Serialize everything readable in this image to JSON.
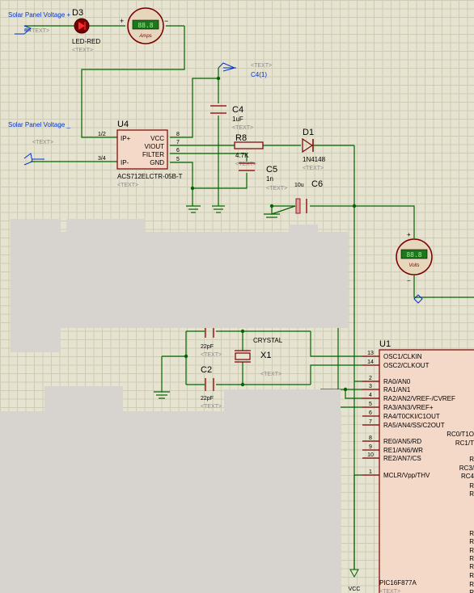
{
  "colors": {
    "wire": "#006400",
    "pin": "#7a0000",
    "body": "#f5d9c8",
    "text": "#000000",
    "label": "#8a8a8a",
    "net": "#0033cc",
    "cap": "#9a1c1c",
    "meter": "#e6d6bc",
    "meterLcd": "#1a7a1a",
    "occluder": "#d7d3cf"
  },
  "terminals": {
    "panel_plus": "Solar Panel Voltage +",
    "panel_minus": "Solar Panel Voltage _",
    "text_tag": "<TEXT>",
    "c4_tag": "C4(1)",
    "vcc": "VCC"
  },
  "d3": {
    "ref": "D3",
    "value": "LED-RED",
    "tag": "<TEXT>"
  },
  "ammeter": {
    "caption": "Amps",
    "plus": "+",
    "minus": "−",
    "lcd": "88.8"
  },
  "voltmeter": {
    "caption": "Volts",
    "plus": "+",
    "minus": "−",
    "lcd": "88.8"
  },
  "u4": {
    "ref": "U4",
    "part": "ACS712ELCTR-05B-T",
    "tag": "<TEXT>",
    "pins_left": [
      {
        "label": "IP+",
        "num": "1/2"
      },
      {
        "label": "IP-",
        "num": "3/4"
      }
    ],
    "pins_right": [
      {
        "label": "VCC",
        "num": "8"
      },
      {
        "label": "VIOUT",
        "num": "7"
      },
      {
        "label": "FILTER",
        "num": "6"
      },
      {
        "label": "GND",
        "num": "5"
      }
    ]
  },
  "c4": {
    "ref": "C4",
    "value": "1uF",
    "tag": "<TEXT>"
  },
  "r8": {
    "ref": "R8",
    "value": "4.7K",
    "tag": "<TEXT>"
  },
  "c5": {
    "ref": "C5",
    "value": "1n",
    "tag": "<TEXT>"
  },
  "d1": {
    "ref": "D1",
    "value": "1N4148",
    "tag": "<TEXT>"
  },
  "c6": {
    "ref": "C6",
    "value": "10u",
    "tag": "<TEXT>"
  },
  "crystal": {
    "name": "CRYSTAL",
    "ref": "X1",
    "tag": "<TEXT>"
  },
  "c1": {
    "value": "22pF",
    "tag": "<TEXT>"
  },
  "c2": {
    "ref": "C2",
    "value": "22pF",
    "tag": "<TEXT>"
  },
  "u1": {
    "ref": "U1",
    "part": "PIC16F877A",
    "pins": [
      {
        "num": "13",
        "label": "OSC1/CLKIN"
      },
      {
        "num": "14",
        "label": "OSC2/CLKOUT"
      },
      {
        "num": "2",
        "label": "RA0/AN0"
      },
      {
        "num": "3",
        "label": "RA1/AN1"
      },
      {
        "num": "4",
        "label": "RA2/AN2/VREF-/CVREF"
      },
      {
        "num": "5",
        "label": "RA3/AN3/VREF+"
      },
      {
        "num": "6",
        "label": "RA4/T0CKI/C1OUT"
      },
      {
        "num": "7",
        "label": "RA5/AN4/SS/C2OUT"
      },
      {
        "num": "8",
        "label": "RE0/AN5/RD"
      },
      {
        "num": "9",
        "label": "RE1/AN6/WR"
      },
      {
        "num": "10",
        "label": "RE2/AN7/CS"
      },
      {
        "num": "1",
        "label": "MCLR/Vpp/THV"
      }
    ],
    "right_labels": [
      "RC0/T1O",
      "RC1/T",
      "R",
      "RC3/",
      "RC4",
      "R",
      "R",
      "R",
      "R",
      "R",
      "R",
      "R",
      "R",
      "R",
      "R"
    ]
  }
}
